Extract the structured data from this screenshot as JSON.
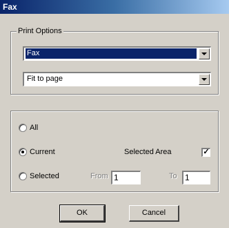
{
  "window": {
    "title": "Fax"
  },
  "print_options": {
    "legend": "Print Options",
    "printer_select": {
      "value": "Fax",
      "icon": "chevron-down-icon"
    },
    "scaling_select": {
      "value": "Fit to page",
      "icon": "chevron-down-icon"
    }
  },
  "range": {
    "all_label": "All",
    "current_label": "Current",
    "selected_label": "Selected",
    "selected_option": "Current",
    "selected_area_label": "Selected Area",
    "selected_area_checked": true,
    "checkmark": "✓",
    "from_label": "From",
    "from_value": "1",
    "to_label": "To",
    "to_value": "1"
  },
  "buttons": {
    "ok": "OK",
    "cancel": "Cancel"
  },
  "colors": {
    "face": "#d4d0c8",
    "title_start": "#0a246a",
    "title_end": "#a6caf0",
    "highlight": "#0a246a"
  }
}
